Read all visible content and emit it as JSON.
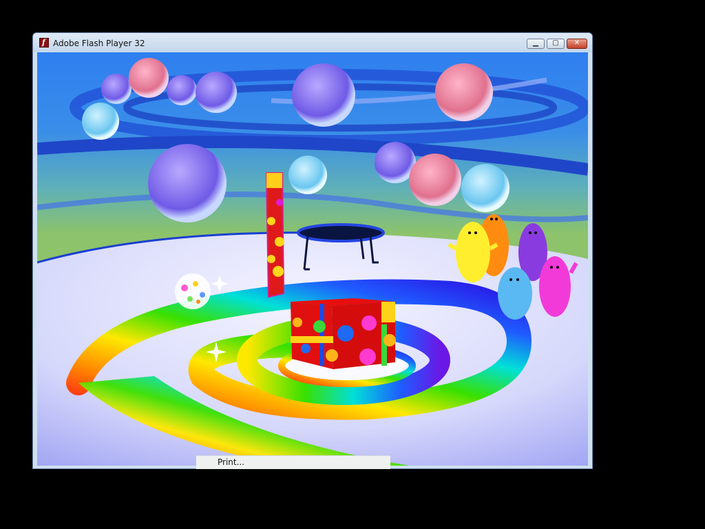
{
  "window": {
    "title": "Adobe Flash Player 32",
    "app_icon_glyph": "f",
    "controls": {
      "minimize": "▁",
      "maximize": "▢",
      "close": "✕"
    }
  },
  "context_menu": {
    "items": [
      "Print..."
    ]
  },
  "scene": {
    "description_icons": [
      "bubble",
      "bouncy-ball",
      "lamp-post",
      "trampoline",
      "gift-box",
      "rainbow-spiral-path",
      "blob-character"
    ],
    "characters": [
      {
        "color": "#ffea2e"
      },
      {
        "color": "#ff9a1a"
      },
      {
        "color": "#8a3be0"
      },
      {
        "color": "#5ab8f2"
      },
      {
        "color": "#f23ad8"
      }
    ]
  }
}
